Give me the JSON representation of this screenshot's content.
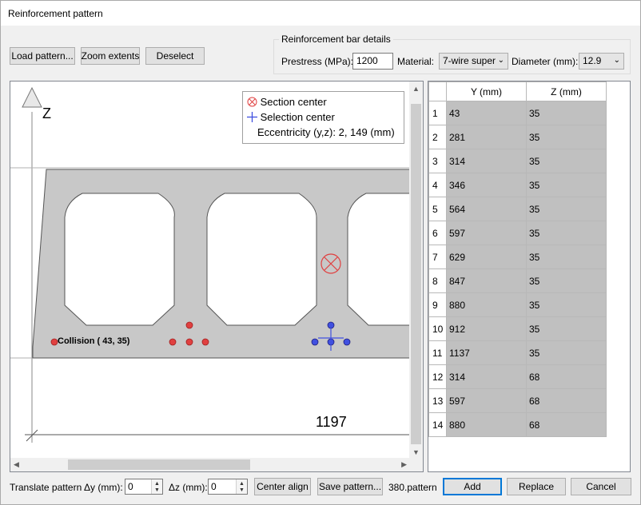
{
  "window": {
    "title": "Reinforcement pattern"
  },
  "toolbar": {
    "load_label": "Load pattern...",
    "zoom_label": "Zoom extents",
    "deselect_label": "Deselect"
  },
  "bar_details": {
    "group_title": "Reinforcement bar details",
    "prestress_label": "Prestress (MPa):",
    "prestress_value": "1200",
    "material_label": "Material:",
    "material_value": "7-wire super",
    "diameter_label": "Diameter (mm):",
    "diameter_value": "12.9"
  },
  "canvas": {
    "axis_label": "Z",
    "dimension_text": "1197",
    "collision_text": "Collision (  43,   35)",
    "legend": {
      "section_center": "Section center",
      "selection_center": "Selection center",
      "eccentricity": "Eccentricity (y,z): 2, 149 (mm)"
    },
    "colors": {
      "section_fill": "#c8c8c8",
      "bar_red": "#e04040",
      "bar_blue": "#4050e0"
    }
  },
  "grid": {
    "headers": [
      "Y (mm)",
      "Z (mm)"
    ],
    "rows": [
      {
        "n": "1",
        "y": "43",
        "z": "35"
      },
      {
        "n": "2",
        "y": "281",
        "z": "35"
      },
      {
        "n": "3",
        "y": "314",
        "z": "35"
      },
      {
        "n": "4",
        "y": "346",
        "z": "35"
      },
      {
        "n": "5",
        "y": "564",
        "z": "35"
      },
      {
        "n": "6",
        "y": "597",
        "z": "35"
      },
      {
        "n": "7",
        "y": "629",
        "z": "35"
      },
      {
        "n": "8",
        "y": "847",
        "z": "35"
      },
      {
        "n": "9",
        "y": "880",
        "z": "35"
      },
      {
        "n": "10",
        "y": "912",
        "z": "35"
      },
      {
        "n": "11",
        "y": "1137",
        "z": "35"
      },
      {
        "n": "12",
        "y": "314",
        "z": "68"
      },
      {
        "n": "13",
        "y": "597",
        "z": "68"
      },
      {
        "n": "14",
        "y": "880",
        "z": "68"
      }
    ]
  },
  "bottom": {
    "translate_label": "Translate pattern",
    "dy_label": "Δy (mm):",
    "dy_value": "0",
    "dz_label": "Δz (mm):",
    "dz_value": "0",
    "center_align_label": "Center align",
    "save_label": "Save pattern...",
    "filename": "380.pattern",
    "add_label": "Add",
    "replace_label": "Replace",
    "cancel_label": "Cancel"
  }
}
